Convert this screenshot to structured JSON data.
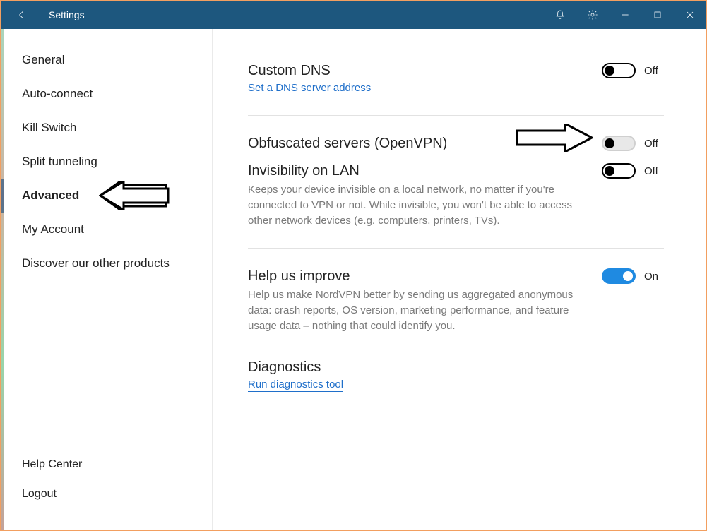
{
  "titlebar": {
    "title": "Settings"
  },
  "sidebar": {
    "items": [
      {
        "label": "General"
      },
      {
        "label": "Auto-connect"
      },
      {
        "label": "Kill Switch"
      },
      {
        "label": "Split tunneling"
      },
      {
        "label": "Advanced",
        "active": true
      },
      {
        "label": "My Account"
      },
      {
        "label": "Discover our other products"
      }
    ],
    "bottom": [
      {
        "label": "Help Center"
      },
      {
        "label": "Logout"
      }
    ]
  },
  "settings": {
    "custom_dns": {
      "title": "Custom DNS",
      "link": "Set a DNS server address",
      "state_label": "Off"
    },
    "obfuscated": {
      "title": "Obfuscated servers (OpenVPN)",
      "state_label": "Off"
    },
    "lan": {
      "title": "Invisibility on LAN",
      "desc": "Keeps your device invisible on a local network, no matter if you're connected to VPN or not. While invisible, you won't be able to access other network devices (e.g. computers, printers, TVs).",
      "state_label": "Off"
    },
    "improve": {
      "title": "Help us improve",
      "desc": "Help us make NordVPN better by sending us aggregated anonymous data: crash reports, OS version, marketing performance, and feature usage data – nothing that could identify you.",
      "state_label": "On"
    },
    "diagnostics": {
      "title": "Diagnostics",
      "link": "Run diagnostics tool"
    }
  }
}
